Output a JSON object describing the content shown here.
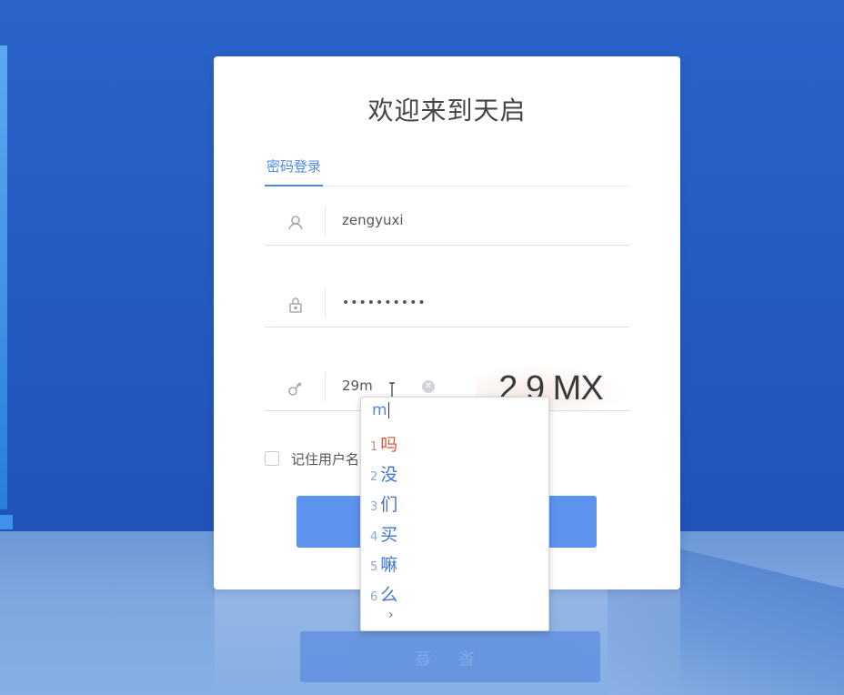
{
  "window": {
    "title": "欢迎来到天启"
  },
  "tabs": [
    {
      "label": "密码登录",
      "active": true
    }
  ],
  "form": {
    "username": {
      "value": "zengyuxi",
      "icon": "user-icon"
    },
    "password": {
      "value": "••••••••••",
      "icon": "lock-icon"
    },
    "captcha": {
      "value": "29m",
      "icon": "key-icon",
      "image_text": "2 9 MX"
    },
    "remember_label": "记住用户名"
  },
  "login_button": {
    "label": ""
  },
  "ime": {
    "composition": "m",
    "candidates": [
      {
        "num": "1",
        "text": "吗"
      },
      {
        "num": "2",
        "text": "没"
      },
      {
        "num": "3",
        "text": "们"
      },
      {
        "num": "4",
        "text": "买"
      },
      {
        "num": "5",
        "text": "嘛"
      },
      {
        "num": "6",
        "text": "么"
      }
    ],
    "more": "›"
  },
  "colors": {
    "accent": "#4f8ae8",
    "button": "#5b93ef",
    "background": "#2257bd",
    "ime_highlight": "#dd5a3a"
  }
}
